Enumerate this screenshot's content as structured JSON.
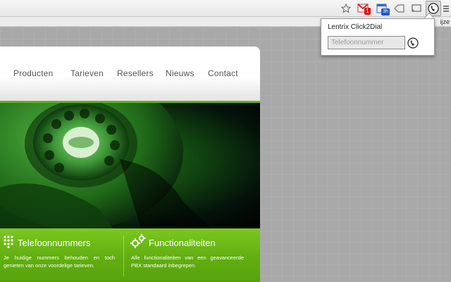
{
  "browser": {
    "toolbar_icons": [
      "star-icon",
      "gmail-icon",
      "calendar-icon",
      "tag-icon",
      "cast-icon",
      "click2dial-icon",
      "menu-icon"
    ],
    "gmail_badge": "1",
    "calendar_badge": "3h",
    "bookmark_cut_text": "ijze"
  },
  "site": {
    "nav": [
      "Producten",
      "Tarieven",
      "Resellers",
      "Nieuws",
      "Contact"
    ],
    "features": [
      {
        "title": "Telefoonnummers",
        "text": "Je huidige nummers behouden en toch genieten van onze voordelige tarieven."
      },
      {
        "title": "Functionaliteiten",
        "text": "Alle functionaliteiten van een geavanceerde PBX standaard inbegrepen."
      }
    ],
    "colors": {
      "accent_green": "#5fb21b",
      "hero_green": "#2a7a1e"
    }
  },
  "popup": {
    "title": "Lentrix Click2Dial",
    "input_placeholder": "Telefoonnummer",
    "input_value": ""
  }
}
